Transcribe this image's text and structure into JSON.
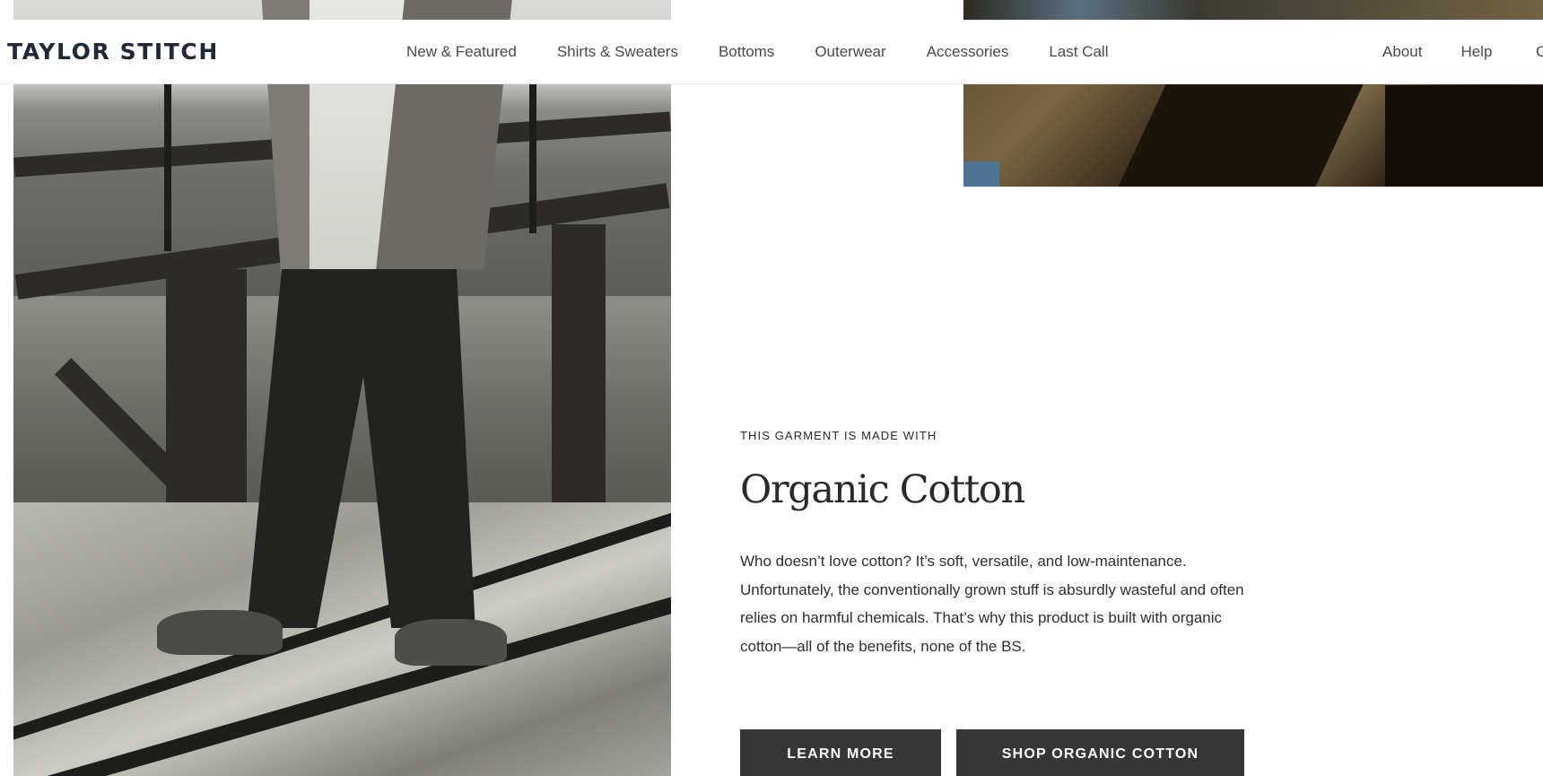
{
  "brand": {
    "logo_text": "TAYLOR STITCH"
  },
  "nav": {
    "main_items": [
      {
        "label": "New & Featured"
      },
      {
        "label": "Shirts & Sweaters"
      },
      {
        "label": "Bottoms"
      },
      {
        "label": "Outerwear"
      },
      {
        "label": "Accessories"
      },
      {
        "label": "Last Call"
      }
    ],
    "right_items": [
      {
        "label": "About"
      },
      {
        "label": "Help"
      }
    ],
    "cut_off_item_initial": "C"
  },
  "feature": {
    "eyebrow": "THIS GARMENT IS MADE WITH",
    "heading": "Organic Cotton",
    "body": "Who doesn’t love cotton? It’s soft, versatile, and low-maintenance. Unfortunately, the conventionally grown stuff is absurdly wasteful and often relies on harmful chemicals. That’s why this product is built with organic cotton—all of the benefits, none of the BS.",
    "buttons": {
      "learn_more": "LEARN MORE",
      "shop": "SHOP ORGANIC COTTON"
    }
  },
  "colors": {
    "logo": "#1f2a36",
    "button_bg": "#363636",
    "button_text": "#ffffff",
    "nav_text": "#4a4a4a"
  }
}
